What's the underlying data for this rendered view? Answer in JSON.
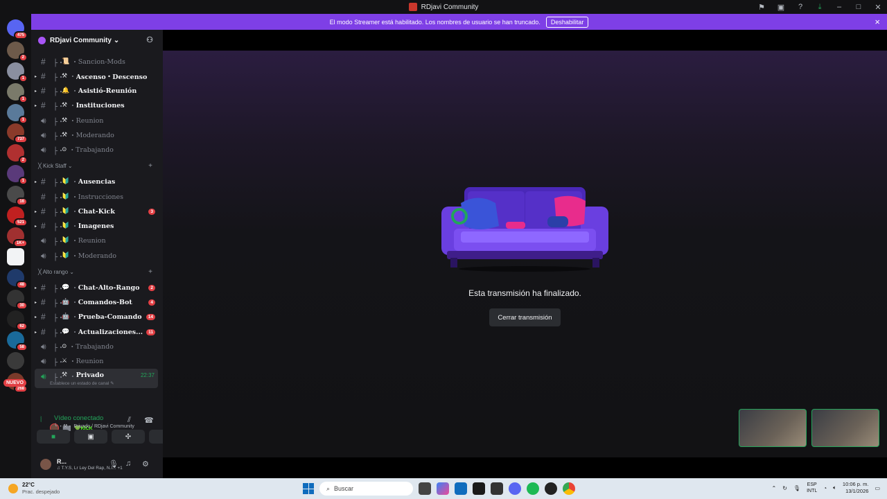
{
  "window": {
    "title": "RDjavi Community"
  },
  "banner": {
    "text": "El modo Streamer está habilitado. Los nombres de usuario se han truncado.",
    "button": "Deshabilitar",
    "close_icon": "×"
  },
  "servers": [
    {
      "badge": "475",
      "color": "#5865f2"
    },
    {
      "badge": "2",
      "color": "#6d5a4a"
    },
    {
      "badge": "1",
      "color": "#8a8fa0"
    },
    {
      "badge": "1",
      "color": "#7a7a6a"
    },
    {
      "badge": "1",
      "color": "#5a7a9a"
    },
    {
      "badge": "737",
      "color": "#8a3a2a"
    },
    {
      "badge": "2",
      "color": "#b03030"
    },
    {
      "badge": "1",
      "color": "#5a3a7a"
    },
    {
      "badge": "16",
      "color": "#4a4a4a"
    },
    {
      "badge": "521",
      "color": "#c02020"
    },
    {
      "badge": "1K+",
      "color": "#a03030"
    },
    {
      "badge": "",
      "color": "#f2f3f5"
    },
    {
      "badge": "48",
      "color": "#1f3a6a"
    },
    {
      "badge": "30",
      "color": "#333333"
    },
    {
      "badge": "62",
      "color": "#222222"
    },
    {
      "badge": "58",
      "color": "#1a6a9a"
    },
    {
      "badge": "",
      "color": "#3a3a3a"
    },
    {
      "badge": "268",
      "color": "#7a3a2a"
    }
  ],
  "nuevo": "NUEVO",
  "guild": {
    "name": "RDjavi Community"
  },
  "channels": [
    {
      "name": "Sancion-Mods",
      "emoji": "📜",
      "style": "muted",
      "type": "text",
      "badge": ""
    },
    {
      "name": "Ascenso・Descenso",
      "emoji": "⚒",
      "style": "bold",
      "type": "text",
      "badge": ""
    },
    {
      "name": "Asistió-Reunión",
      "emoji": "🔔",
      "style": "bold",
      "type": "text",
      "badge": ""
    },
    {
      "name": "Instituciones",
      "emoji": "⚒",
      "style": "bold",
      "type": "text",
      "badge": ""
    },
    {
      "name": "Reunion",
      "emoji": "⚒",
      "style": "muted",
      "type": "voice",
      "badge": ""
    },
    {
      "name": "Moderando",
      "emoji": "⚒",
      "style": "muted",
      "type": "voice",
      "badge": ""
    },
    {
      "name": "Trabajando",
      "emoji": "⊙",
      "style": "muted",
      "type": "voice",
      "badge": ""
    },
    {
      "name": "Ausencias",
      "emoji": "🔰",
      "style": "bold",
      "type": "text",
      "badge": ""
    },
    {
      "name": "Instrucciones",
      "emoji": "🔰",
      "style": "muted",
      "type": "text",
      "badge": ""
    },
    {
      "name": "Chat-Kick",
      "emoji": "🔰",
      "style": "bold",
      "type": "text",
      "badge": "3"
    },
    {
      "name": "Imagenes",
      "emoji": "🔰",
      "style": "bold",
      "type": "text",
      "badge": ""
    },
    {
      "name": "Reunion",
      "emoji": "🔰",
      "style": "muted",
      "type": "voice",
      "badge": ""
    },
    {
      "name": "Moderando",
      "emoji": "🔰",
      "style": "muted",
      "type": "voice",
      "badge": ""
    },
    {
      "name": "Chat-Alto-Rango",
      "emoji": "💬",
      "style": "bold",
      "type": "text",
      "badge": "2"
    },
    {
      "name": "Comandos-Bot",
      "emoji": "🤖",
      "style": "bold",
      "type": "text",
      "badge": "4"
    },
    {
      "name": "Prueba-Comando",
      "emoji": "🤖",
      "style": "bold",
      "type": "text",
      "badge": "14"
    },
    {
      "name": "Actualizaciones...",
      "emoji": "💬",
      "style": "bold",
      "type": "text",
      "badge": "11"
    },
    {
      "name": "Trabajando",
      "emoji": "⊙",
      "style": "muted",
      "type": "voice",
      "badge": ""
    },
    {
      "name": "Reunion",
      "emoji": "⚔",
      "style": "muted",
      "type": "voice",
      "badge": ""
    }
  ],
  "categories": [
    {
      "name": "╳ Kick Staff ⌄"
    },
    {
      "name": "╳ Alto rango ⌄"
    }
  ],
  "active_channel": {
    "name": "Privado",
    "emoji": "⚒",
    "time": "22:37",
    "sub": "Establece un estado de canal ✎"
  },
  "member": {
    "name": "▇▇",
    "tag": "💚KICK"
  },
  "voice": {
    "title": "Vídeo conectado",
    "sub": "╰ ・⚒・ Privado / RDjavi Community"
  },
  "user": {
    "name": "R...",
    "status": "♫ T.Y.S, Lr Ley Del Rap, N.I...  +1"
  },
  "stream": {
    "ended_text": "Esta transmisión ha finalizado.",
    "close_button": "Cerrar transmisión"
  },
  "taskbar": {
    "temp": "22°C",
    "weather": "Prac. despejado",
    "search_placeholder": "Buscar",
    "lang_1": "ESP",
    "lang_2": "INTL",
    "time": "10:06 p. m.",
    "date": "13/1/2026"
  }
}
